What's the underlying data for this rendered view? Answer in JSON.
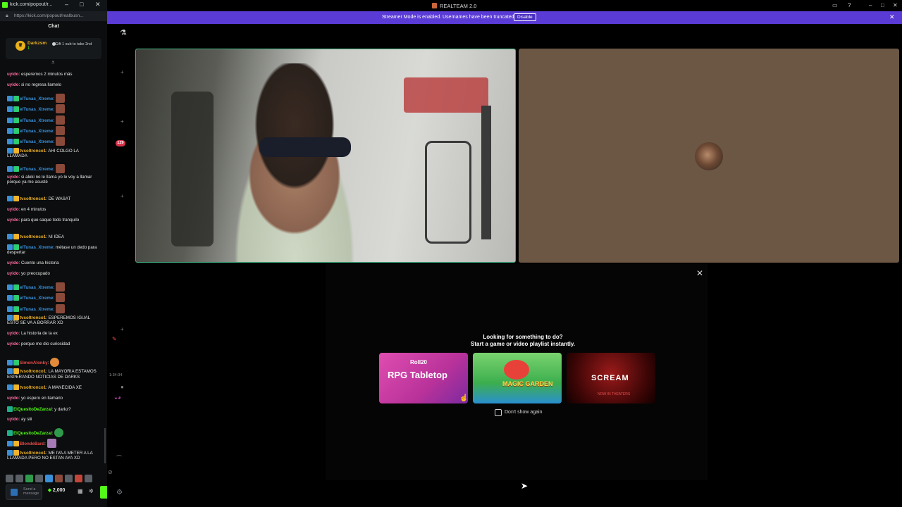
{
  "popout": {
    "window_title": "kick.com/popout/r...",
    "url": "https://kick.com/popout/realbusn...",
    "chat_header": "Chat",
    "pinned": {
      "user": "Darkzsm",
      "badge": "1",
      "text": "Gift 1 sub to take 2nd"
    },
    "messages": [
      {
        "user": "uyido",
        "user_color": "#ff6fa0",
        "badges": [],
        "text": "esperemos 2 minutos más"
      },
      {
        "user": "uyido",
        "user_color": "#ff6fa0",
        "badges": [],
        "text": "si no regresa llamelo"
      },
      {
        "user": "elTunas_Xtreme",
        "user_color": "#3a8fd8",
        "badges": [
          "blue",
          "green"
        ],
        "text": "",
        "emote": "emote"
      },
      {
        "user": "elTunas_Xtreme",
        "user_color": "#3a8fd8",
        "badges": [
          "blue",
          "green"
        ],
        "text": "",
        "emote": "emote"
      },
      {
        "user": "elTunas_Xtreme",
        "user_color": "#3a8fd8",
        "badges": [
          "blue",
          "green"
        ],
        "text": "",
        "emote": "emote"
      },
      {
        "user": "elTunas_Xtreme",
        "user_color": "#3a8fd8",
        "badges": [
          "blue",
          "green"
        ],
        "text": "",
        "emote": "emote"
      },
      {
        "user": "elTunas_Xtreme",
        "user_color": "#3a8fd8",
        "badges": [
          "blue",
          "green"
        ],
        "text": "",
        "emote": "emote"
      },
      {
        "user": "tvsoltronco1",
        "user_color": "#f0b429",
        "badges": [
          "blue",
          "gold"
        ],
        "text": "AHI COLGO LA LLAMADA"
      },
      {
        "user": "elTunas_Xtreme",
        "user_color": "#3a8fd8",
        "badges": [
          "blue",
          "green"
        ],
        "text": "",
        "emote": "emote"
      },
      {
        "user": "uyido",
        "user_color": "#ff6fa0",
        "badges": [],
        "text": "si aleki no le llama yo le voy a llamar porque ya me asusté"
      },
      {
        "user": "tvsoltronco1",
        "user_color": "#f0b429",
        "badges": [
          "blue",
          "gold"
        ],
        "text": "DE WASAT"
      },
      {
        "user": "uyido",
        "user_color": "#ff6fa0",
        "badges": [],
        "text": "en 4 minutos"
      },
      {
        "user": "uyido",
        "user_color": "#ff6fa0",
        "badges": [],
        "text": "para que saque todo tranquilo"
      },
      {
        "user": "tvsoltronco1",
        "user_color": "#f0b429",
        "badges": [
          "blue",
          "gold"
        ],
        "text": "NI IDEA"
      },
      {
        "user": "elTunas_Xtreme",
        "user_color": "#3a8fd8",
        "badges": [
          "blue",
          "green"
        ],
        "text": "métase un dedo para despertar"
      },
      {
        "user": "uyido",
        "user_color": "#ff6fa0",
        "badges": [],
        "text": "Cuente una historia"
      },
      {
        "user": "uyido",
        "user_color": "#ff6fa0",
        "badges": [],
        "text": "yo preocupado"
      },
      {
        "user": "elTunas_Xtreme",
        "user_color": "#3a8fd8",
        "badges": [
          "blue",
          "green"
        ],
        "text": "",
        "emote": "emote"
      },
      {
        "user": "elTunas_Xtreme",
        "user_color": "#3a8fd8",
        "badges": [
          "blue",
          "green"
        ],
        "text": "",
        "emote": "emote"
      },
      {
        "user": "elTunas_Xtreme",
        "user_color": "#3a8fd8",
        "badges": [
          "blue",
          "green"
        ],
        "text": "",
        "emote": "emote"
      },
      {
        "user": "tvsoltronco1",
        "user_color": "#f0b429",
        "badges": [
          "blue",
          "gold"
        ],
        "text": "ESPEREMOS IGUAL ESTO SE VA A BORRAR XD"
      },
      {
        "user": "uyido",
        "user_color": "#ff6fa0",
        "badges": [],
        "text": "La historia de la ex"
      },
      {
        "user": "uyido",
        "user_color": "#ff6fa0",
        "badges": [],
        "text": "porque me dio curiosidad"
      },
      {
        "user": "SimonAlonky",
        "user_color": "#e84a4a",
        "badges": [
          "blue",
          "green"
        ],
        "text": "",
        "emote": "emote o"
      },
      {
        "user": "tvsoltronco1",
        "user_color": "#f0b429",
        "badges": [
          "blue",
          "gold"
        ],
        "text": "LA MAYORIA ESTAMOS ESPERANDO NOTICIAS DE DARKS"
      },
      {
        "user": "tvsoltronco1",
        "user_color": "#f0b429",
        "badges": [
          "blue",
          "gold"
        ],
        "text": "A MANECIDA XE"
      },
      {
        "user": "uyido",
        "user_color": "#ff6fa0",
        "badges": [],
        "text": "yo espero en llamario"
      },
      {
        "user": "ElQuesitoDeZarzal",
        "user_color": "#53fc18",
        "badges": [
          "sub"
        ],
        "text": "y darkz?"
      },
      {
        "user": "uyido",
        "user_color": "#ff6fa0",
        "badges": [],
        "text": "ay siii"
      },
      {
        "user": "ElQuesitoDeZarzal",
        "user_color": "#53fc18",
        "badges": [
          "sub"
        ],
        "text": "",
        "emote": "emote g"
      },
      {
        "user": "BlondeBard",
        "user_color": "#e84a4a",
        "badges": [
          "blue",
          "gold"
        ],
        "text": "",
        "emote": "emote p"
      },
      {
        "user": "tvsoltronco1",
        "user_color": "#f0b429",
        "badges": [
          "blue",
          "gold"
        ],
        "text": "ME IVA A METER A LA LLAMADA PERO NO ESTAN AYA XD"
      }
    ],
    "input_placeholder": "Send a message",
    "points": "2,000"
  },
  "rail": {
    "badge": "129",
    "time": "1:34:34"
  },
  "main": {
    "window_title": "REALTEAM 2.0",
    "banner_text": "Streamer Mode is enabled. Usernames have been truncated.",
    "banner_button": "Disable",
    "activity": {
      "heading_line1": "Looking for something to do?",
      "heading_line2": "Start a game or video playlist instantly.",
      "cards": [
        {
          "logo": "Roll20",
          "title": "RPG Tabletop"
        },
        {
          "title": "MAGIC GARDEN"
        },
        {
          "title": "SCREAM",
          "sub": "NOW IN THEATERS"
        }
      ],
      "checkbox_label": "Don't show again"
    }
  },
  "colors": {
    "kick_green": "#53fc18",
    "banner": "#5a3bd6",
    "speaking_border": "#43b581"
  }
}
